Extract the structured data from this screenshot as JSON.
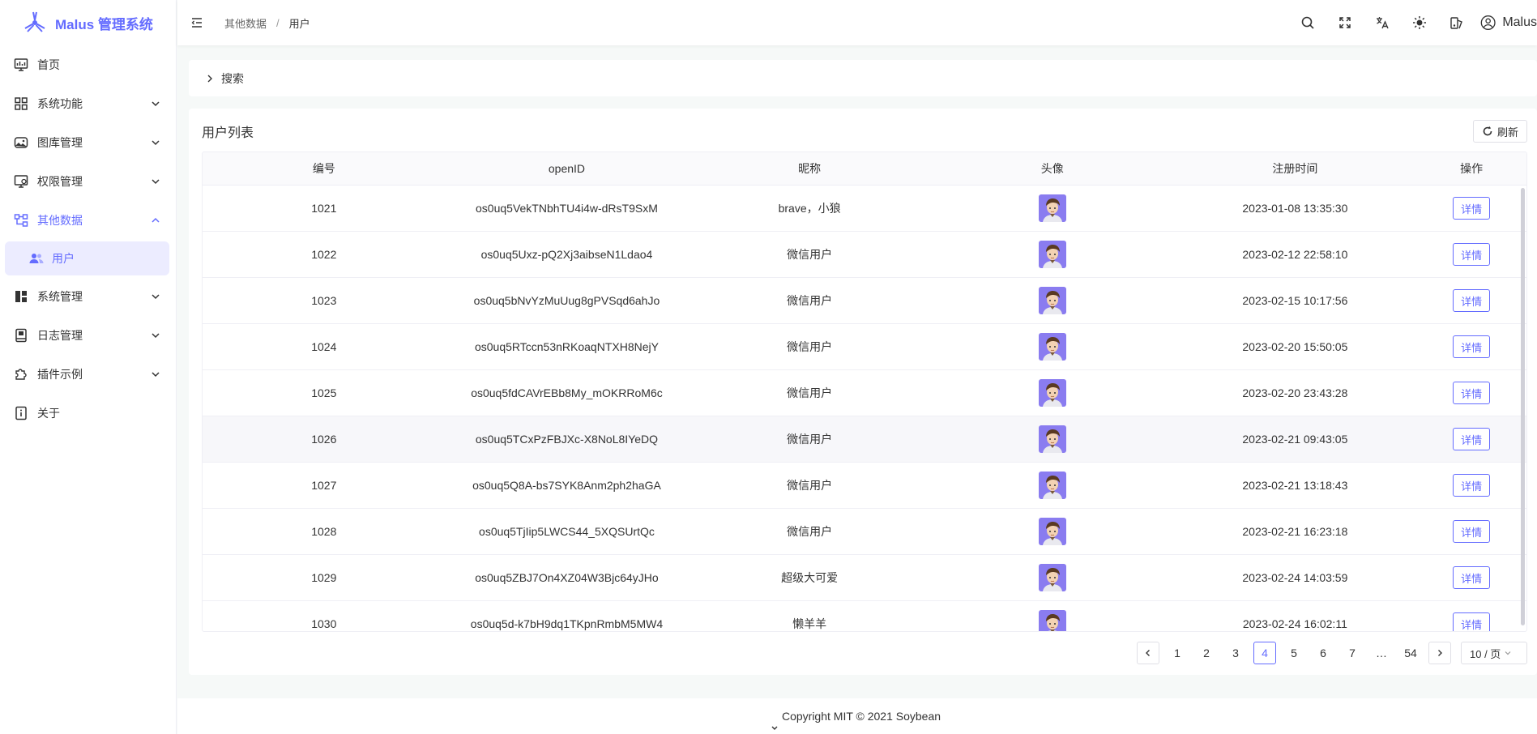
{
  "app": {
    "title": "Malus 管理系统",
    "brand_color": "#646cff"
  },
  "sidebar": {
    "items": [
      {
        "label": "首页",
        "icon": "monitor-dashboard-icon",
        "expandable": false
      },
      {
        "label": "系统功能",
        "icon": "grid-icon",
        "expandable": true
      },
      {
        "label": "图库管理",
        "icon": "image-gallery-icon",
        "expandable": true
      },
      {
        "label": "权限管理",
        "icon": "permission-monitor-icon",
        "expandable": true
      },
      {
        "label": "其他数据",
        "icon": "data-hierarchy-icon",
        "expandable": true,
        "expanded": true,
        "children": [
          {
            "label": "用户",
            "icon": "users-icon",
            "active": true
          }
        ]
      },
      {
        "label": "系统管理",
        "icon": "layout-dashboard-icon",
        "expandable": true
      },
      {
        "label": "日志管理",
        "icon": "log-book-icon",
        "expandable": true
      },
      {
        "label": "插件示例",
        "icon": "plugin-puzzle-icon",
        "expandable": true
      },
      {
        "label": "关于",
        "icon": "info-icon",
        "expandable": false
      }
    ]
  },
  "header": {
    "breadcrumb": [
      "其他数据",
      "用户"
    ],
    "breadcrumb_separator": "/",
    "actions": [
      "search-icon",
      "fullscreen-icon",
      "language-icon",
      "theme-sun-icon",
      "theme-settings-icon"
    ],
    "user_name": "Malus"
  },
  "search_panel": {
    "label": "搜索",
    "collapsed": true
  },
  "user_table": {
    "title": "用户列表",
    "refresh_label": "刷新",
    "columns": [
      "编号",
      "openID",
      "昵称",
      "头像",
      "注册时间",
      "操作"
    ],
    "action_label": "详情",
    "rows": [
      {
        "id": "1021",
        "openid": "os0uq5VekTNbhTU4i4w-dRsT9SxM",
        "nickname": "brave，小狼",
        "registered": "2023-01-08 13:35:30"
      },
      {
        "id": "1022",
        "openid": "os0uq5Uxz-pQ2Xj3aibseN1Ldao4",
        "nickname": "微信用户",
        "registered": "2023-02-12 22:58:10"
      },
      {
        "id": "1023",
        "openid": "os0uq5bNvYzMuUug8gPVSqd6ahJo",
        "nickname": "微信用户",
        "registered": "2023-02-15 10:17:56"
      },
      {
        "id": "1024",
        "openid": "os0uq5RTccn53nRKoaqNTXH8NejY",
        "nickname": "微信用户",
        "registered": "2023-02-20 15:50:05"
      },
      {
        "id": "1025",
        "openid": "os0uq5fdCAVrEBb8My_mOKRRoM6c",
        "nickname": "微信用户",
        "registered": "2023-02-20 23:43:28"
      },
      {
        "id": "1026",
        "openid": "os0uq5TCxPzFBJXc-X8NoL8IYeDQ",
        "nickname": "微信用户",
        "registered": "2023-02-21 09:43:05"
      },
      {
        "id": "1027",
        "openid": "os0uq5Q8A-bs7SYK8Anm2ph2haGA",
        "nickname": "微信用户",
        "registered": "2023-02-21 13:18:43"
      },
      {
        "id": "1028",
        "openid": "os0uq5TjIip5LWCS44_5XQSUrtQc",
        "nickname": "微信用户",
        "registered": "2023-02-21 16:23:18"
      },
      {
        "id": "1029",
        "openid": "os0uq5ZBJ7On4XZ04W3Bjc64yJHo",
        "nickname": "超级大可爱",
        "registered": "2023-02-24 14:03:59"
      },
      {
        "id": "1030",
        "openid": "os0uq5d-k7bH9dq1TKpnRmbM5MW4",
        "nickname": "懒羊羊",
        "registered": "2023-02-24 16:02:11"
      }
    ],
    "hovered_row": "1026"
  },
  "pagination": {
    "pages": [
      "1",
      "2",
      "3",
      "4",
      "5",
      "6",
      "7",
      "…",
      "54"
    ],
    "current": "4",
    "page_size_label": "10 / 页"
  },
  "footer": {
    "copyright": "Copyright MIT © 2021 Soybean"
  }
}
